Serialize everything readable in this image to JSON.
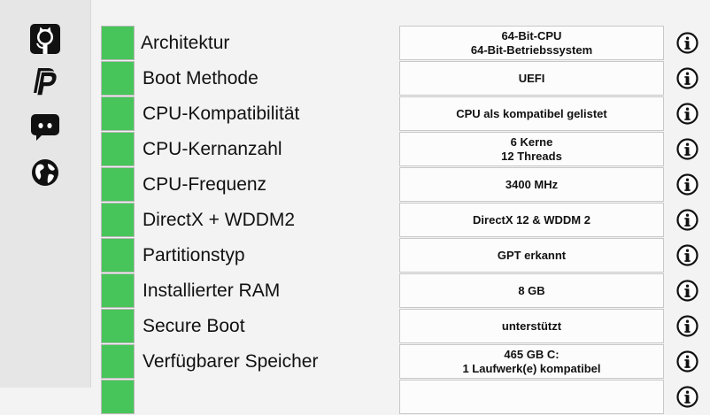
{
  "sidebar": {
    "items": [
      {
        "icon": "github-icon"
      },
      {
        "icon": "paypal-icon"
      },
      {
        "icon": "discord-icon"
      },
      {
        "icon": "globe-icon"
      }
    ]
  },
  "colors": {
    "status_ok": "#47c55a",
    "sidebar_bg": "#e6e6e6",
    "page_bg": "#f3f3f3"
  },
  "checks": [
    {
      "label": "Architektur",
      "value_line1": "64-Bit-CPU",
      "value_line2": "64-Bit-Betriebssystem",
      "status": "ok"
    },
    {
      "label": "Boot Methode",
      "value_line1": "UEFI",
      "value_line2": "",
      "status": "ok"
    },
    {
      "label": "CPU-Kompatibilität",
      "value_line1": "CPU als kompatibel gelistet",
      "value_line2": "",
      "status": "ok"
    },
    {
      "label": "CPU-Kernanzahl",
      "value_line1": "6 Kerne",
      "value_line2": "12 Threads",
      "status": "ok"
    },
    {
      "label": "CPU-Frequenz",
      "value_line1": "3400 MHz",
      "value_line2": "",
      "status": "ok"
    },
    {
      "label": "DirectX + WDDM2",
      "value_line1": "DirectX 12 & WDDM 2",
      "value_line2": "",
      "status": "ok"
    },
    {
      "label": "Partitionstyp",
      "value_line1": "GPT erkannt",
      "value_line2": "",
      "status": "ok"
    },
    {
      "label": "Installierter RAM",
      "value_line1": "8 GB",
      "value_line2": "",
      "status": "ok"
    },
    {
      "label": "Secure Boot",
      "value_line1": "unterstützt",
      "value_line2": "",
      "status": "ok"
    },
    {
      "label": "Verfügbarer Speicher",
      "value_line1": "465 GB C:",
      "value_line2": "1 Laufwerk(e) kompatibel",
      "status": "ok"
    },
    {
      "label": "",
      "value_line1": "",
      "value_line2": "",
      "status": "ok"
    }
  ]
}
